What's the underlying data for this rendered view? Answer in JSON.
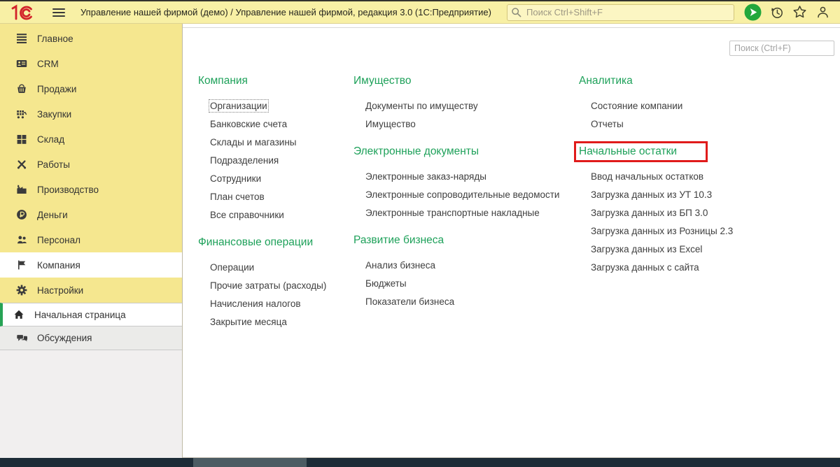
{
  "window": {
    "title": "Управление нашей фирмой (демо) / Управление нашей фирмой, редакция 3.0  (1С:Предприятие)",
    "logo_text": "1С"
  },
  "topbar": {
    "search_placeholder": "Поиск Ctrl+Shift+F"
  },
  "sidebar": {
    "items": [
      "Главное",
      "CRM",
      "Продажи",
      "Закупки",
      "Склад",
      "Работы",
      "Производство",
      "Деньги",
      "Персонал",
      "Компания",
      "Настройки"
    ],
    "footer_items": [
      "Начальная страница",
      "Обсуждения"
    ]
  },
  "content": {
    "search_placeholder": "Поиск (Ctrl+F)",
    "columns": [
      {
        "sections": [
          {
            "title": "Компания",
            "items": [
              "Организации",
              "Банковские счета",
              "Склады и магазины",
              "Подразделения",
              "Сотрудники",
              "План счетов",
              "Все справочники"
            ]
          },
          {
            "title": "Финансовые операции",
            "items": [
              "Операции",
              "Прочие затраты (расходы)",
              "Начисления налогов",
              "Закрытие месяца"
            ]
          }
        ]
      },
      {
        "sections": [
          {
            "title": "Имущество",
            "items": [
              "Документы по имуществу",
              "Имущество"
            ]
          },
          {
            "title": "Электронные документы",
            "items": [
              "Электронные заказ-наряды",
              "Электронные сопроводительные ведомости",
              "Электронные транспортные накладные"
            ]
          },
          {
            "title": "Развитие бизнеса",
            "items": [
              "Анализ бизнеса",
              "Бюджеты",
              "Показатели бизнеса"
            ]
          }
        ]
      },
      {
        "sections": [
          {
            "title": "Аналитика",
            "items": [
              "Состояние компании",
              "Отчеты"
            ]
          },
          {
            "title": "Начальные остатки",
            "items": [
              "Ввод начальных остатков",
              "Загрузка данных из УТ 10.3",
              "Загрузка данных из БП 3.0",
              "Загрузка данных из Розницы 2.3",
              "Загрузка данных из Excel",
              "Загрузка данных с сайта"
            ]
          }
        ]
      }
    ]
  },
  "colors": {
    "accent_green": "#1ea15a",
    "highlight_red": "#e01b1b",
    "topbar_bg": "#f8f0a5",
    "sidebar_bg": "#f5e78f",
    "play_button_green": "#22a73c",
    "logo_red": "#d2232a",
    "bottombar_bg": "#1d2c37"
  }
}
